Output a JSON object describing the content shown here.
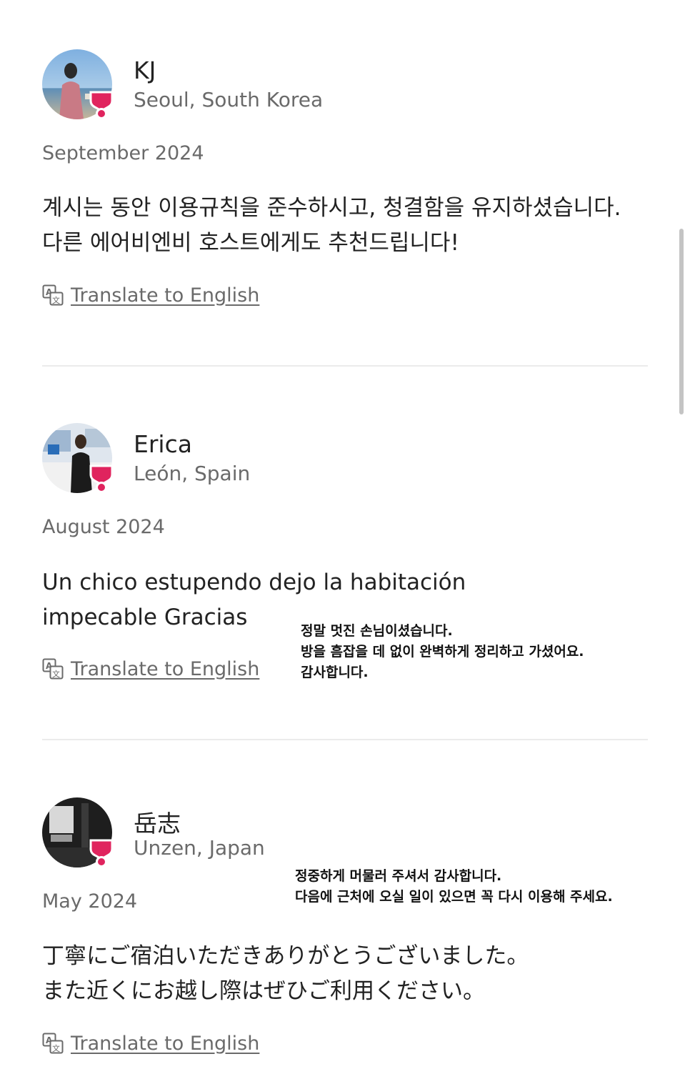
{
  "translate_label": "Translate to English",
  "reviews": [
    {
      "name": "KJ",
      "location": "Seoul, South Korea",
      "date": "September 2024",
      "text_lines": [
        "계시는 동안 이용규칙을 준수하시고, 청결함을 유지하셨습니다.",
        "다른 에어비엔비 호스트에게도 추천드립니다!"
      ]
    },
    {
      "name": "Erica",
      "location": "León, Spain",
      "date": "August 2024",
      "text_lines": [
        "Un chico estupendo dejo la habitación",
        "impecable Gracias"
      ],
      "note_lines": [
        "정말 멋진 손님이셨습니다.",
        "방을 흠잡을 데 없이 완벽하게 정리하고 가셨어요.",
        "감사합니다."
      ]
    },
    {
      "name": "岳志",
      "location": "Unzen, Japan",
      "date": "May 2024",
      "text_lines": [
        "丁寧にご宿泊いただきありがとうございました。",
        "また近くにお越し際はぜひご利用ください。"
      ],
      "note_lines": [
        "정중하게 머물러 주셔서 감사합니다.",
        "다음에 근처에 오실 일이 있으면 꼭 다시 이용해 주세요."
      ]
    }
  ],
  "colors": {
    "text_primary": "#222222",
    "text_secondary": "#6a6a6a",
    "badge": "#E0245E",
    "divider": "#ebebeb"
  },
  "icons": [
    "translate-icon",
    "superhost-badge-icon"
  ]
}
